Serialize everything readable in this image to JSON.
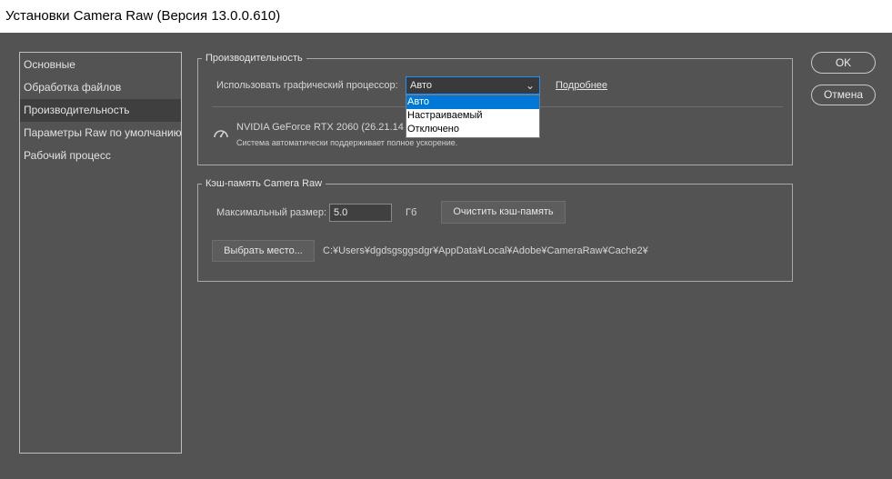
{
  "window": {
    "title": "Установки Camera Raw  (Версия 13.0.0.610)"
  },
  "sidebar": {
    "items": [
      {
        "label": "Основные",
        "active": false
      },
      {
        "label": "Обработка файлов",
        "active": false
      },
      {
        "label": "Производительность",
        "active": true
      },
      {
        "label": "Параметры Raw по умолчанию",
        "active": false
      },
      {
        "label": "Рабочий процесс",
        "active": false
      }
    ]
  },
  "performance": {
    "legend": "Производительность",
    "gpu_label": "Использовать графический процессор:",
    "gpu_select": {
      "value": "Авто",
      "options": [
        "Авто",
        "Настраиваемый",
        "Отключено"
      ]
    },
    "more_link": "Подробнее",
    "gpu_name": "NVIDIA GeForce RTX 2060 (26.21.14.",
    "gpu_status": "Система автоматически поддерживает полное ускорение.",
    "icon": "speedometer-icon"
  },
  "cache": {
    "legend": "Кэш-память Camera Raw",
    "max_size_label": "Максимальный размер:",
    "max_size_value": "5.0",
    "unit": "Гб",
    "clear_button": "Очистить кэш-память",
    "choose_button": "Выбрать место...",
    "path": "C:¥Users¥dgdsgsggsdgr¥AppData¥Local¥Adobe¥CameraRaw¥Cache2¥"
  },
  "actions": {
    "ok": "OK",
    "cancel": "Отмена"
  }
}
